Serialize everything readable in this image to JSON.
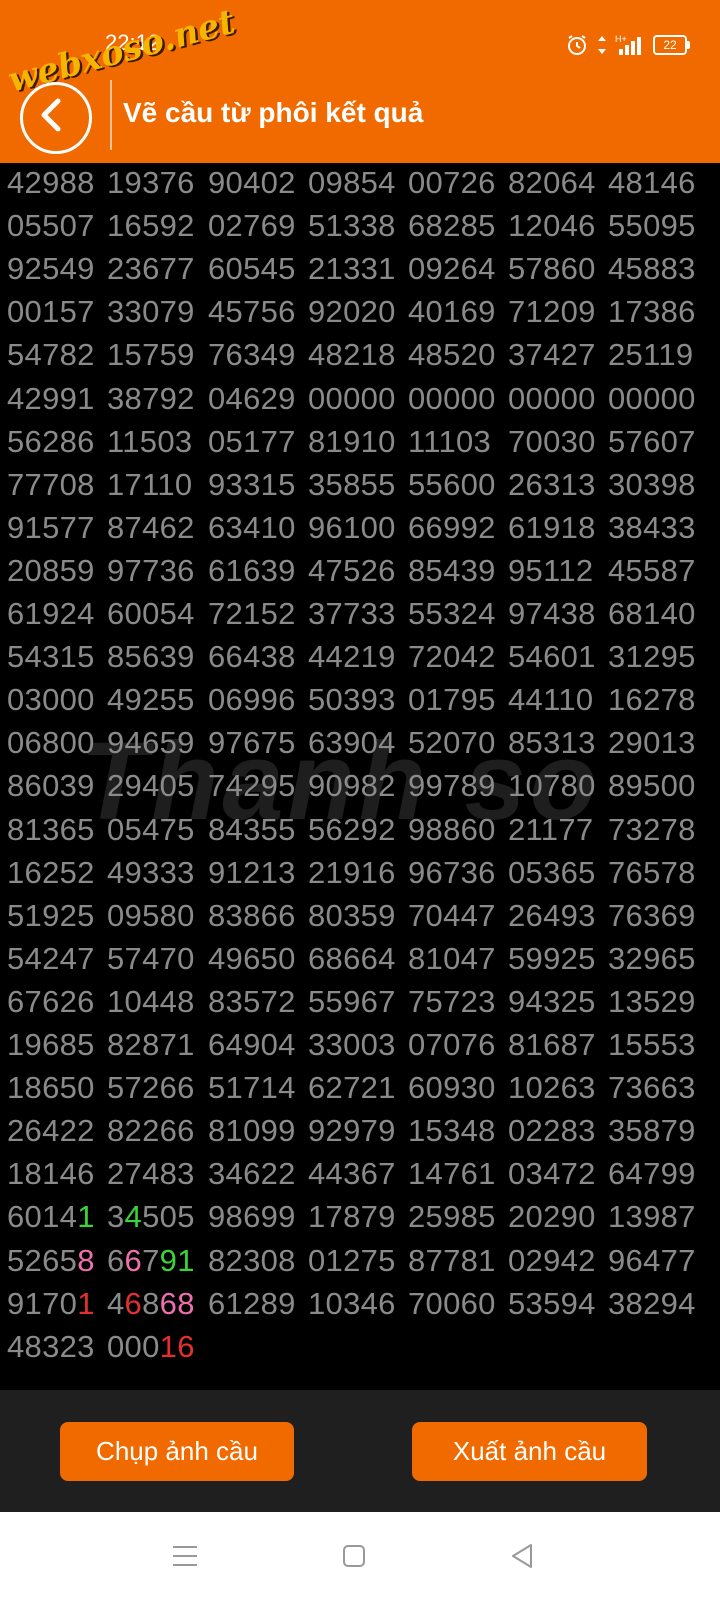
{
  "status_bar": {
    "time": "22:12",
    "watermark": "webxoso.net",
    "battery": "22"
  },
  "header": {
    "title": "Vẽ cầu từ phôi kết quả"
  },
  "background_watermark": "Thanh so",
  "grid": {
    "rows": [
      [
        "42988",
        "19376",
        "90402",
        "09854",
        "00726",
        "82064",
        "48146"
      ],
      [
        "05507",
        "16592",
        "02769",
        "51338",
        "68285",
        "12046",
        "55095"
      ],
      [
        "92549",
        "23677",
        "60545",
        "21331",
        "09264",
        "57860",
        "45883"
      ],
      [
        "00157",
        "33079",
        "45756",
        "92020",
        "40169",
        "71209",
        "17386"
      ],
      [
        "54782",
        "15759",
        "76349",
        "48218",
        "48520",
        "37427",
        "25119"
      ],
      [
        "42991",
        "38792",
        "04629",
        "00000",
        "00000",
        "00000",
        "00000"
      ],
      [
        "56286",
        "11503",
        "05177",
        "81910",
        "11103",
        "70030",
        "57607"
      ],
      [
        "77708",
        "17110",
        "93315",
        "35855",
        "55600",
        "26313",
        "30398"
      ],
      [
        "91577",
        "87462",
        "63410",
        "96100",
        "66992",
        "61918",
        "38433"
      ],
      [
        "20859",
        "97736",
        "61639",
        "47526",
        "85439",
        "95112",
        "45587"
      ],
      [
        "61924",
        "60054",
        "72152",
        "37733",
        "55324",
        "97438",
        "68140"
      ],
      [
        "54315",
        "85639",
        "66438",
        "44219",
        "72042",
        "54601",
        "31295"
      ],
      [
        "03000",
        "49255",
        "06996",
        "50393",
        "01795",
        "44110",
        "16278"
      ],
      [
        "06800",
        "94659",
        "97675",
        "63904",
        "52070",
        "85313",
        "29013"
      ],
      [
        "86039",
        "29405",
        "74295",
        "90982",
        "99789",
        "10780",
        "89500"
      ],
      [
        "81365",
        "05475",
        "84355",
        "56292",
        "98860",
        "21177",
        "73278"
      ],
      [
        "16252",
        "49333",
        "91213",
        "21916",
        "96736",
        "05365",
        "76578"
      ],
      [
        "51925",
        "09580",
        "83866",
        "80359",
        "70447",
        "26493",
        "76369"
      ],
      [
        "54247",
        "57470",
        "49650",
        "68664",
        "81047",
        "59925",
        "32965"
      ],
      [
        "67626",
        "10448",
        "83572",
        "55967",
        "75723",
        "94325",
        "13529"
      ],
      [
        "19685",
        "82871",
        "64904",
        "33003",
        "07076",
        "81687",
        "15553"
      ],
      [
        "18650",
        "57266",
        "51714",
        "62721",
        "60930",
        "10263",
        "73663"
      ],
      [
        "26422",
        "82266",
        "81099",
        "92979",
        "15348",
        "02283",
        "35879"
      ],
      [
        "18146",
        "27483",
        "34622",
        "44367",
        "14761",
        "03472",
        "64799"
      ],
      [
        "60141",
        "34505",
        "98699",
        "17879",
        "25985",
        "20290",
        "13987"
      ],
      [
        "52658",
        "66791",
        "82308",
        "01275",
        "87781",
        "02942",
        "96477"
      ],
      [
        "91701",
        "46868",
        "61289",
        "10346",
        "70060",
        "53594",
        "38294"
      ],
      [
        "48323",
        "00016"
      ]
    ],
    "highlights": [
      {
        "row": 24,
        "col": 0,
        "chars": [
          {
            "i": 4,
            "c": "#3ad33a"
          }
        ]
      },
      {
        "row": 24,
        "col": 1,
        "chars": [
          {
            "i": 1,
            "c": "#3ad33a"
          }
        ]
      },
      {
        "row": 25,
        "col": 0,
        "chars": [
          {
            "i": 4,
            "c": "#ee6fb0"
          }
        ]
      },
      {
        "row": 25,
        "col": 1,
        "chars": [
          {
            "i": 1,
            "c": "#ee6fb0"
          },
          {
            "i": 3,
            "c": "#3ad33a"
          },
          {
            "i": 4,
            "c": "#3ad33a"
          }
        ]
      },
      {
        "row": 26,
        "col": 0,
        "chars": [
          {
            "i": 4,
            "c": "#e23030"
          }
        ]
      },
      {
        "row": 26,
        "col": 1,
        "chars": [
          {
            "i": 1,
            "c": "#e23030"
          },
          {
            "i": 3,
            "c": "#ee6fb0"
          },
          {
            "i": 4,
            "c": "#ee6fb0"
          }
        ]
      },
      {
        "row": 27,
        "col": 1,
        "chars": [
          {
            "i": 3,
            "c": "#e23030"
          },
          {
            "i": 4,
            "c": "#e23030"
          }
        ]
      }
    ],
    "colors": {
      "default": "#8a8a8a",
      "green": "#3ad33a",
      "pink": "#ee6fb0",
      "red": "#e23030"
    }
  },
  "buttons": {
    "capture": "Chụp ảnh cầu",
    "export": "Xuất ảnh cầu"
  },
  "colors": {
    "accent": "#f06a00",
    "background": "#000000",
    "bottom_bar": "#1f1f1f"
  },
  "nav_bar": {
    "icons": [
      "menu-icon",
      "home-square-icon",
      "back-triangle-icon"
    ]
  }
}
